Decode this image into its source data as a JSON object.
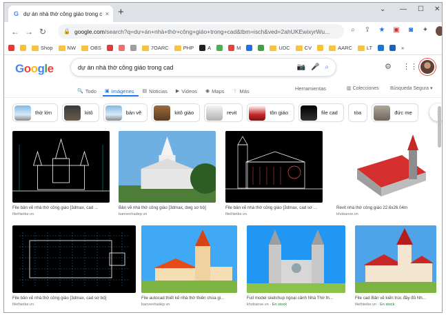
{
  "browser": {
    "tab_title": "dự án nhà thờ công giáo trong c",
    "tab_close": "×",
    "new_tab": "+",
    "window_controls": [
      "⌄",
      "—",
      "☐",
      "✕"
    ],
    "url_host": "google.com",
    "url_path": "/search?q=dự+án+nhà+thờ+công+giáo+trong+cad&tbm=isch&ved=2ahUKEwixyrWu...",
    "bookmarks": [
      {
        "label": "",
        "color": "#e53935"
      },
      {
        "label": "",
        "color": "#fbc02d"
      },
      {
        "label": "Shop",
        "color": "folder"
      },
      {
        "label": "NW",
        "color": "folder"
      },
      {
        "label": "OBS",
        "color": "folder"
      },
      {
        "label": "",
        "color": "#e53935"
      },
      {
        "label": "",
        "color": "#e57373"
      },
      {
        "label": "",
        "color": "#9e9e9e"
      },
      {
        "label": "7OARC",
        "color": "folder"
      },
      {
        "label": "PHP",
        "color": "folder"
      },
      {
        "label": "A",
        "color": "#212121"
      },
      {
        "label": "",
        "color": "#4caf50"
      },
      {
        "label": "M",
        "color": "#ea4335"
      },
      {
        "label": "",
        "color": "#1a73e8"
      },
      {
        "label": "",
        "color": "#43a047"
      },
      {
        "label": "UDC",
        "color": "folder"
      },
      {
        "label": "CV",
        "color": "folder"
      },
      {
        "label": "",
        "color": "#fbc02d"
      },
      {
        "label": "AARC",
        "color": "folder"
      },
      {
        "label": "LT",
        "color": "folder"
      },
      {
        "label": "",
        "color": "#1976d2"
      },
      {
        "label": "",
        "color": "#1565c0"
      },
      {
        "label": "»",
        "color": "none"
      }
    ]
  },
  "google": {
    "logo": [
      {
        "ch": "G",
        "color": "#4285f4"
      },
      {
        "ch": "o",
        "color": "#ea4335"
      },
      {
        "ch": "o",
        "color": "#fbbc05"
      },
      {
        "ch": "g",
        "color": "#4285f4"
      },
      {
        "ch": "l",
        "color": "#34a853"
      },
      {
        "ch": "e",
        "color": "#ea4335"
      }
    ],
    "query": "dự án nhà thờ công giáo trong cad",
    "tabs": [
      {
        "icon": "🔍",
        "label": "Todo"
      },
      {
        "icon": "▣",
        "label": "Imágenes"
      },
      {
        "icon": "▤",
        "label": "Noticias"
      },
      {
        "icon": "▶",
        "label": "Videos"
      },
      {
        "icon": "◉",
        "label": "Maps"
      },
      {
        "icon": "⋮",
        "label": "Más"
      }
    ],
    "tools": "Herramientas",
    "collections": "Colecciones",
    "safe_search": "Búsqueda Segura ▾"
  },
  "chips": [
    {
      "label": "thờ lớn",
      "thumb": "sky"
    },
    {
      "label": "kitô",
      "thumb": "dark"
    },
    {
      "label": "bản vẽ",
      "thumb": "sky"
    },
    {
      "label": "kitô giáo",
      "thumb": "brown"
    },
    {
      "label": "revit",
      "thumb": "white"
    },
    {
      "label": "tôn giáo",
      "thumb": "red"
    },
    {
      "label": "file cad",
      "thumb": "black"
    },
    {
      "label": "tòa",
      "thumb": ""
    },
    {
      "label": "đức mẹ",
      "thumb": "grey"
    }
  ],
  "results_row1": [
    {
      "caption": "File bản vẽ nhà thờ công giáo [3dmax, cad ...",
      "source": "filethietke.vn",
      "stock": "",
      "kind": "cad-elevation"
    },
    {
      "caption": "Bản vẽ nhà thờ công giáo [3dmax, dwg sơ bộ]",
      "source": "banvenhadep.vn",
      "stock": "",
      "kind": "photo-white-church"
    },
    {
      "caption": "File bản vẽ nhà thờ công giáo [3dmax, cad sơ ...",
      "source": "filethietke.vn",
      "stock": "",
      "kind": "cad-side"
    },
    {
      "caption": "Revit nhà thờ công giáo 22.6x26.04m",
      "source": "khobanve.vn",
      "stock": "",
      "kind": "model-red-roof"
    }
  ],
  "results_row2": [
    {
      "caption": "File bản vẽ nhà thờ công giáo [3dmax, cad sơ bộ]",
      "source": "filethietke.vn",
      "stock": "",
      "kind": "cad-plan"
    },
    {
      "caption": "File autocad thiết kế nhà thờ thiên chúa gi...",
      "source": "banvenhadep.vn",
      "stock": "",
      "kind": "render-orange"
    },
    {
      "caption": "Full model sketchup ngoại cảnh Nhà Thờ th...",
      "source": "khobanve.vn",
      "stock": "En stock",
      "kind": "render-grey"
    },
    {
      "caption": "File cad Bản vẽ kiến trúc đầy đủ Nh...",
      "source": "filethietke.vn",
      "stock": "En stock",
      "kind": "render-red-brick"
    }
  ]
}
